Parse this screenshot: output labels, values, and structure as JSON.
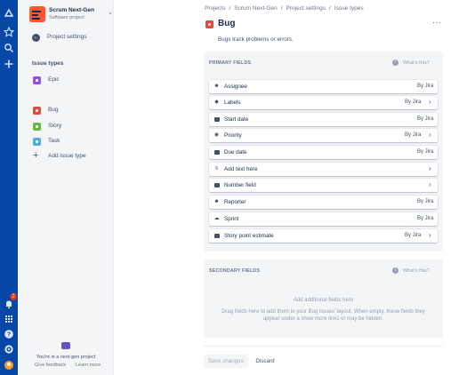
{
  "project": {
    "name": "Scrum Next-Gen",
    "type": "Software project"
  },
  "sidebar": {
    "back_label": "Project settings",
    "section_heading": "Issue types",
    "epic": "Epic",
    "types": [
      {
        "label": "Bug",
        "color": "#e5493a"
      },
      {
        "label": "Story",
        "color": "#63ba3c"
      },
      {
        "label": "Task",
        "color": "#4bade8"
      }
    ],
    "add_label": "Add issue type",
    "epic_color": "#904ee2",
    "footer": {
      "line": "You're in a next-gen project",
      "feedback": "Give feedback",
      "learn": "Learn more"
    }
  },
  "global_nav": {
    "notification_count": "2"
  },
  "breadcrumbs": [
    "Projects",
    "Scrum Next-Gen",
    "Project settings",
    "Issue types"
  ],
  "issue_type": {
    "title": "Bug",
    "description": "Bugs track problems or errors."
  },
  "more_label": "···",
  "primary": {
    "heading": "PRIMARY FIELDS",
    "help": "What's this?",
    "fields": [
      {
        "label": "Assignee",
        "by": "By Jira",
        "chevron": false,
        "icon": "person-icon"
      },
      {
        "label": "Labels",
        "by": "By Jira",
        "chevron": true,
        "icon": "tag-icon"
      },
      {
        "label": "Start date",
        "by": "By Jira",
        "chevron": false,
        "icon": "calendar-icon"
      },
      {
        "label": "Priority",
        "by": "By Jira",
        "chevron": true,
        "icon": "priority-icon"
      },
      {
        "label": "Due date",
        "by": "By Jira",
        "chevron": false,
        "icon": "calendar-icon"
      },
      {
        "label": "Add text here",
        "by": "",
        "chevron": true,
        "icon": "text-icon"
      },
      {
        "label": "Number field",
        "by": "",
        "chevron": true,
        "icon": "number-icon"
      },
      {
        "label": "Reporter",
        "by": "By Jira",
        "chevron": false,
        "icon": "person-icon"
      },
      {
        "label": "Sprint",
        "by": "By Jira",
        "chevron": false,
        "icon": "sprint-icon"
      },
      {
        "label": "Story point estimate",
        "by": "By Jira",
        "chevron": true,
        "icon": "number-icon"
      }
    ]
  },
  "secondary": {
    "heading": "SECONDARY FIELDS",
    "help": "What's this?",
    "empty_title": "Add additional fields here",
    "empty_body": "Drag fields here to add them to your Bug issues' layout. When empty, these fields they appear under a show more links or may be hidden."
  },
  "actions": {
    "save": "Save changes",
    "discard": "Discard"
  }
}
